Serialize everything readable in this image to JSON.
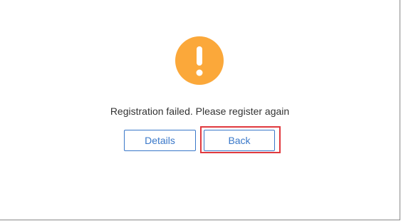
{
  "dialog": {
    "icon": "exclamation-icon",
    "icon_color": "#fba83a",
    "message": "Registration failed. Please register again",
    "buttons": {
      "details_label": "Details",
      "back_label": "Back"
    },
    "accent_color": "#3a78c9",
    "highlight_color": "#e0393e"
  }
}
